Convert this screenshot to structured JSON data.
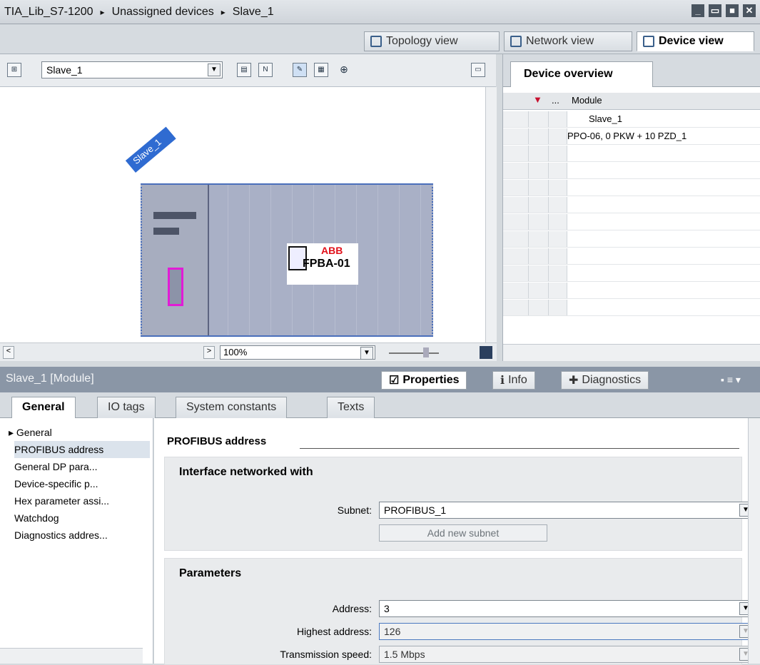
{
  "window": {
    "breadcrumb": [
      "TIA_Lib_S7-1200",
      "Unassigned devices",
      "Slave_1"
    ],
    "breadcrumb_sep": "▸"
  },
  "view_tabs": [
    {
      "label": "Topology view",
      "active": false
    },
    {
      "label": "Network view",
      "active": false
    },
    {
      "label": "Device view",
      "active": true
    }
  ],
  "device_view": {
    "device_selector": "Slave_1",
    "zoom": "100%",
    "device_tag": "Slave_1",
    "module_brand": "ABB",
    "module_name": "FPBA-01"
  },
  "device_overview": {
    "tab_label": "Device overview",
    "header": {
      "dots": "...",
      "module": "Module"
    },
    "rows": [
      "Slave_1",
      "PPO-06, 0 PKW + 10 PZD_1",
      "",
      "",
      "",
      "",
      "",
      "",
      "",
      "",
      "",
      ""
    ]
  },
  "properties": {
    "title": "Slave_1 [Module]",
    "tabs": [
      {
        "label": "Properties",
        "active": true
      },
      {
        "label": "Info",
        "active": false
      },
      {
        "label": "Diagnostics",
        "active": false
      }
    ],
    "subtabs": [
      {
        "label": "General",
        "active": true
      },
      {
        "label": "IO tags",
        "active": false
      },
      {
        "label": "System constants",
        "active": false
      },
      {
        "label": "Texts",
        "active": false
      }
    ],
    "nav": [
      {
        "label": "▸ General",
        "selected": false
      },
      {
        "label": "PROFIBUS address",
        "selected": true
      },
      {
        "label": "General DP para...",
        "selected": false
      },
      {
        "label": "Device-specific p...",
        "selected": false
      },
      {
        "label": "Hex parameter assi...",
        "selected": false
      },
      {
        "label": "Watchdog",
        "selected": false
      },
      {
        "label": "Diagnostics addres...",
        "selected": false
      }
    ],
    "section_title": "PROFIBUS address",
    "interface_group": {
      "title": "Interface networked with",
      "subnet_label": "Subnet:",
      "subnet_value": "PROFIBUS_1",
      "add_subnet_button": "Add new subnet"
    },
    "parameters_group": {
      "title": "Parameters",
      "address_label": "Address:",
      "address_value": "3",
      "highest_label": "Highest address:",
      "highest_value": "126",
      "speed_label": "Transmission speed:",
      "speed_value": "1.5 Mbps"
    }
  }
}
